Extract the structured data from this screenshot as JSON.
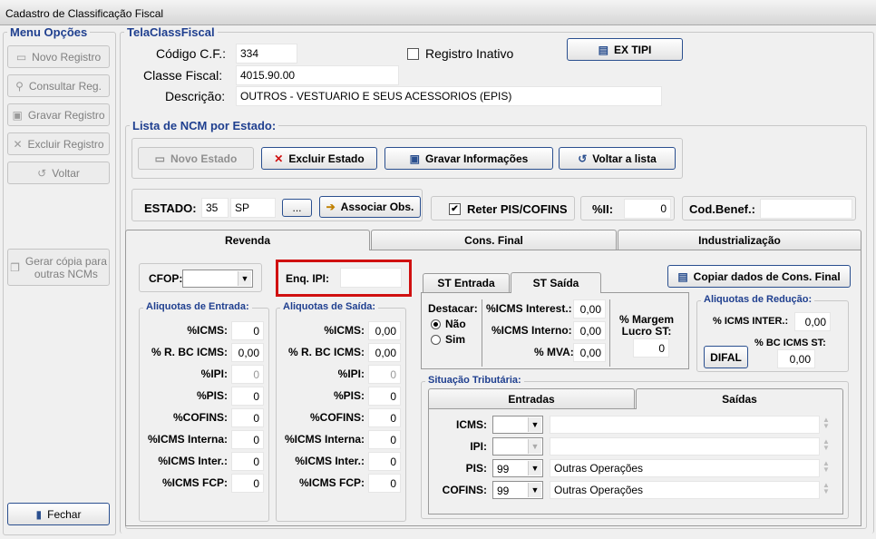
{
  "window": {
    "title": "Cadastro de Classificação Fiscal"
  },
  "sidebar": {
    "legend": "Menu Opções",
    "buttons": [
      "Novo Registro",
      "Consultar Reg.",
      "Gravar Registro",
      "Excluir Registro",
      "Voltar"
    ],
    "copy_button": [
      "Gerar cópia para",
      "outras NCMs"
    ],
    "close_button": "Fechar"
  },
  "header": {
    "legend": "TelaClassFiscal",
    "codigo_label": "Código C.F.:",
    "codigo_value": "334",
    "classe_label": "Classe Fiscal:",
    "classe_value": "4015.90.00",
    "descricao_label": "Descrição:",
    "descricao_value": "OUTROS - VESTUARIO E SEUS ACESSORIOS (EPIS)",
    "inativo_label": "Registro Inativo",
    "inativo_checked": false,
    "extipi_button": "EX TIPI"
  },
  "ncm": {
    "legend": "Lista de NCM por Estado:",
    "buttons": {
      "novo": "Novo Estado",
      "excluir": "Excluir Estado",
      "gravar": "Gravar Informações",
      "voltar": "Voltar a lista"
    },
    "estado_label": "ESTADO:",
    "estado_code": "35",
    "estado_uf": "SP",
    "ellipsis": "...",
    "associar": "Associar Obs.",
    "reter_label": "Reter PIS/COFINS",
    "reter_checked": true,
    "ii_label": "%II:",
    "ii_value": "0",
    "codbenef_label": "Cod.Benef.:",
    "codbenef_value": ""
  },
  "tabs": [
    "Revenda",
    "Cons. Final",
    "Industrialização"
  ],
  "revenda": {
    "cfop_label": "CFOP:",
    "cfop_value": "",
    "enq_label": "Enq. IPI:",
    "enq_value": "",
    "entrada": {
      "legend": "Aliquotas de Entrada:",
      "labels": [
        "%ICMS:",
        "% R. BC ICMS:",
        "%IPI:",
        "%PIS:",
        "%COFINS:",
        "%ICMS Interna:",
        "%ICMS Inter.:",
        "%ICMS FCP:"
      ],
      "values": [
        "0",
        "0,00",
        "0",
        "0",
        "0",
        "0",
        "0",
        "0"
      ]
    },
    "saida": {
      "legend": "Aliquotas de Saída:",
      "labels": [
        "%ICMS:",
        "% R. BC ICMS:",
        "%IPI:",
        "%PIS:",
        "%COFINS:",
        "%ICMS Interna:",
        "%ICMS Inter.:",
        "%ICMS FCP:"
      ],
      "values": [
        "0,00",
        "0,00",
        "0",
        "0",
        "0",
        "0",
        "0",
        "0"
      ]
    },
    "st_tabs": [
      "ST Entrada",
      "ST Saída"
    ],
    "st": {
      "destacar_label": "Destacar:",
      "nao": "Não",
      "sim": "Sim",
      "icms_interest_label": "%ICMS Interest.:",
      "icms_interest_value": "0,00",
      "icms_interno_label": "%ICMS Interno:",
      "icms_interno_value": "0,00",
      "mva_label": "% MVA:",
      "mva_value": "0,00",
      "margem_label": [
        "% Margem",
        "Lucro ST:"
      ],
      "margem_value": "0"
    },
    "copiar_button": "Copiar dados de Cons. Final",
    "reducao": {
      "legend": "Aliquotas de Redução:",
      "icms_inter_label": "% ICMS INTER.:",
      "icms_inter_value": "0,00",
      "bc_icms_st_label": "% BC ICMS ST:",
      "bc_icms_st_value": "0,00",
      "difal_button": "DIFAL"
    },
    "situacao": {
      "legend": "Situação Tributária:",
      "tabs": [
        "Entradas",
        "Saídas"
      ],
      "rows": [
        {
          "label": "ICMS:",
          "code": "",
          "desc": ""
        },
        {
          "label": "IPI:",
          "code": "",
          "desc": ""
        },
        {
          "label": "PIS:",
          "code": "99",
          "desc": "Outras Operações"
        },
        {
          "label": "COFINS:",
          "code": "99",
          "desc": "Outras Operações"
        }
      ]
    }
  },
  "colors": {
    "legend_blue": "#1f3f8f",
    "highlight_red": "#d01010",
    "button_border": "#2a4f8f"
  }
}
